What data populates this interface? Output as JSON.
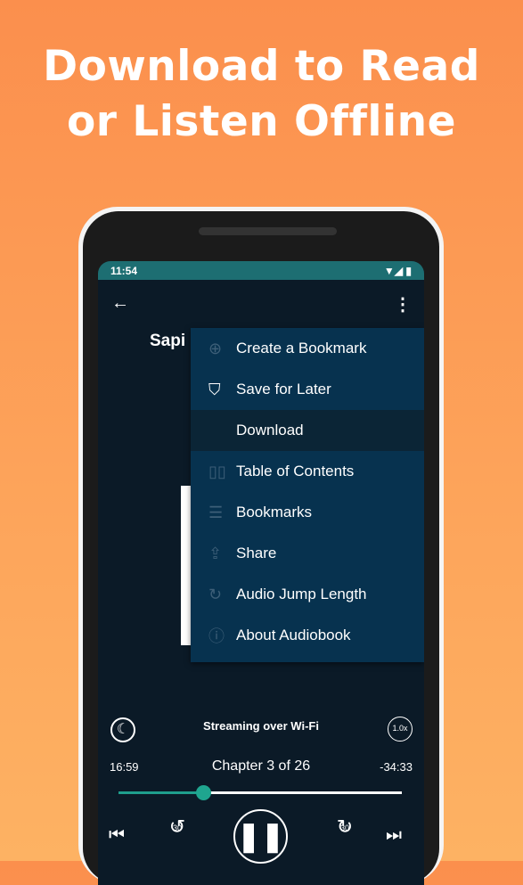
{
  "headline": {
    "line1": "Download to Read",
    "line2": "or Listen Offline"
  },
  "status_bar": {
    "time": "11:54",
    "icons": [
      "wifi-icon",
      "signal-icon",
      "battery-icon"
    ]
  },
  "app_bar": {
    "back_icon": "arrow-left-icon",
    "more_icon": "more-vertical-icon"
  },
  "book": {
    "title_visible": "Sapi"
  },
  "menu": {
    "items": [
      {
        "label": "Create a Bookmark",
        "icon": "plus-circle-icon"
      },
      {
        "label": "Save for Later",
        "icon": "bookmark-icon"
      },
      {
        "label": "Download",
        "icon": "",
        "selected": true
      },
      {
        "label": "Table of Contents",
        "icon": "book-open-icon"
      },
      {
        "label": "Bookmarks",
        "icon": "list-icon"
      },
      {
        "label": "Share",
        "icon": "share-icon"
      },
      {
        "label": "Audio Jump Length",
        "icon": "rotate-icon"
      },
      {
        "label": "About Audiobook",
        "icon": "info-icon"
      }
    ]
  },
  "player": {
    "streaming": "Streaming over Wi-Fi",
    "speed": "1.0x",
    "elapsed": "16:59",
    "remaining": "-34:33",
    "chapter": "Chapter 3 of 26",
    "progress": 0.3,
    "skip_back": "30",
    "skip_fwd": "30"
  },
  "colors": {
    "accent": "#1fa58f",
    "status_bar": "#1d6e72",
    "menu_bg": "#07324f",
    "screen_bg": "#0b1a27"
  }
}
